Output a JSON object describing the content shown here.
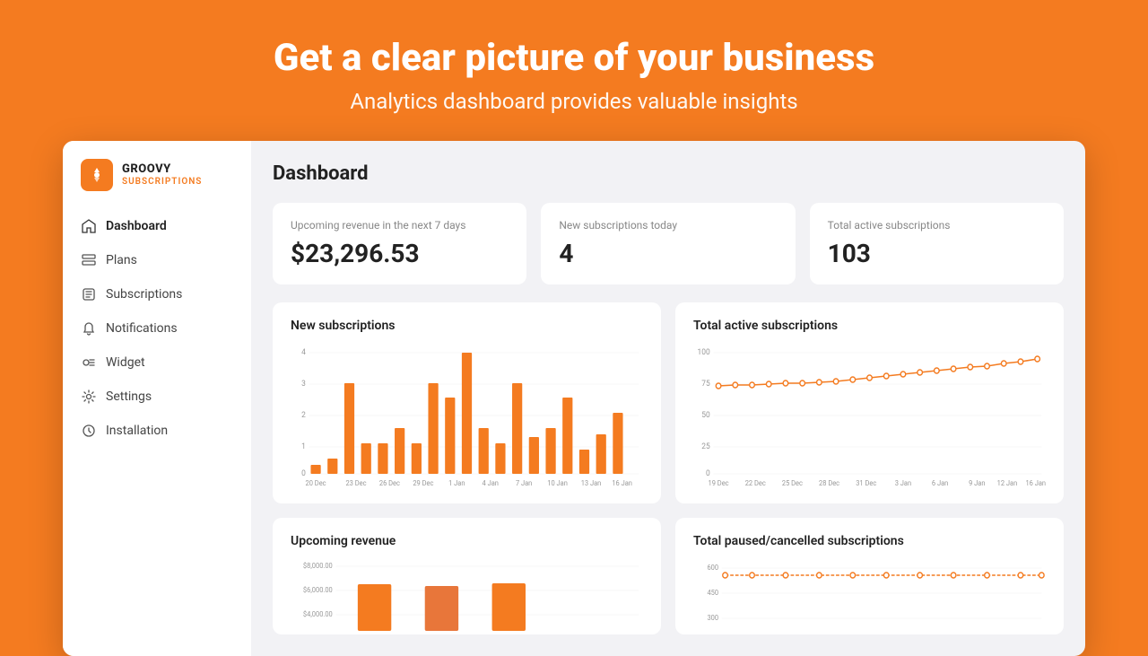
{
  "hero": {
    "heading": "Get a clear picture of your business",
    "subheading": "Analytics dashboard provides valuable insights"
  },
  "sidebar": {
    "logo": {
      "brand": "GROOVY",
      "sub": "SUBSCRIPTIONS"
    },
    "nav": [
      {
        "label": "Dashboard",
        "icon": "home",
        "active": true
      },
      {
        "label": "Plans",
        "icon": "plans"
      },
      {
        "label": "Subscriptions",
        "icon": "subscriptions"
      },
      {
        "label": "Notifications",
        "icon": "notifications"
      },
      {
        "label": "Widget",
        "icon": "widget"
      },
      {
        "label": "Settings",
        "icon": "settings"
      },
      {
        "label": "Installation",
        "icon": "installation"
      }
    ]
  },
  "page": {
    "title": "Dashboard"
  },
  "stats": [
    {
      "label": "Upcoming revenue in the next 7 days",
      "value": "$23,296.53"
    },
    {
      "label": "New subscriptions today",
      "value": "4"
    },
    {
      "label": "Total active subscriptions",
      "value": "103"
    }
  ],
  "charts": {
    "new_subscriptions": {
      "title": "New subscriptions",
      "x_labels": [
        "20 Dec",
        "23 Dec",
        "26 Dec",
        "29 Dec",
        "1 Jan",
        "4 Jan",
        "7 Jan",
        "10 Jan",
        "13 Jan",
        "16 Jan"
      ],
      "y_max": 4,
      "bars": [
        0.3,
        0.5,
        3,
        1,
        1,
        1.5,
        1,
        3,
        2.5,
        4,
        1.5,
        1,
        3,
        1.2,
        1.5,
        2.5,
        0.8,
        1.3,
        2
      ]
    },
    "total_active": {
      "title": "Total active subscriptions",
      "x_labels": [
        "19 Dec",
        "22 Dec",
        "25 Dec",
        "28 Dec",
        "31 Dec",
        "3 Jan",
        "6 Jan",
        "9 Jan",
        "12 Jan",
        "16 Jan"
      ],
      "y_labels": [
        "0",
        "25",
        "50",
        "75",
        "100"
      ],
      "start": 73,
      "end": 103
    },
    "upcoming_revenue": {
      "title": "Upcoming revenue",
      "y_labels": [
        "$8,000.00",
        "$6,000.00",
        "$4,000.00"
      ]
    },
    "paused_cancelled": {
      "title": "Total paused/cancelled subscriptions",
      "y_labels": [
        "600",
        "450",
        "300"
      ]
    }
  },
  "colors": {
    "orange": "#F47B20",
    "orange_light": "#F9A05C"
  }
}
